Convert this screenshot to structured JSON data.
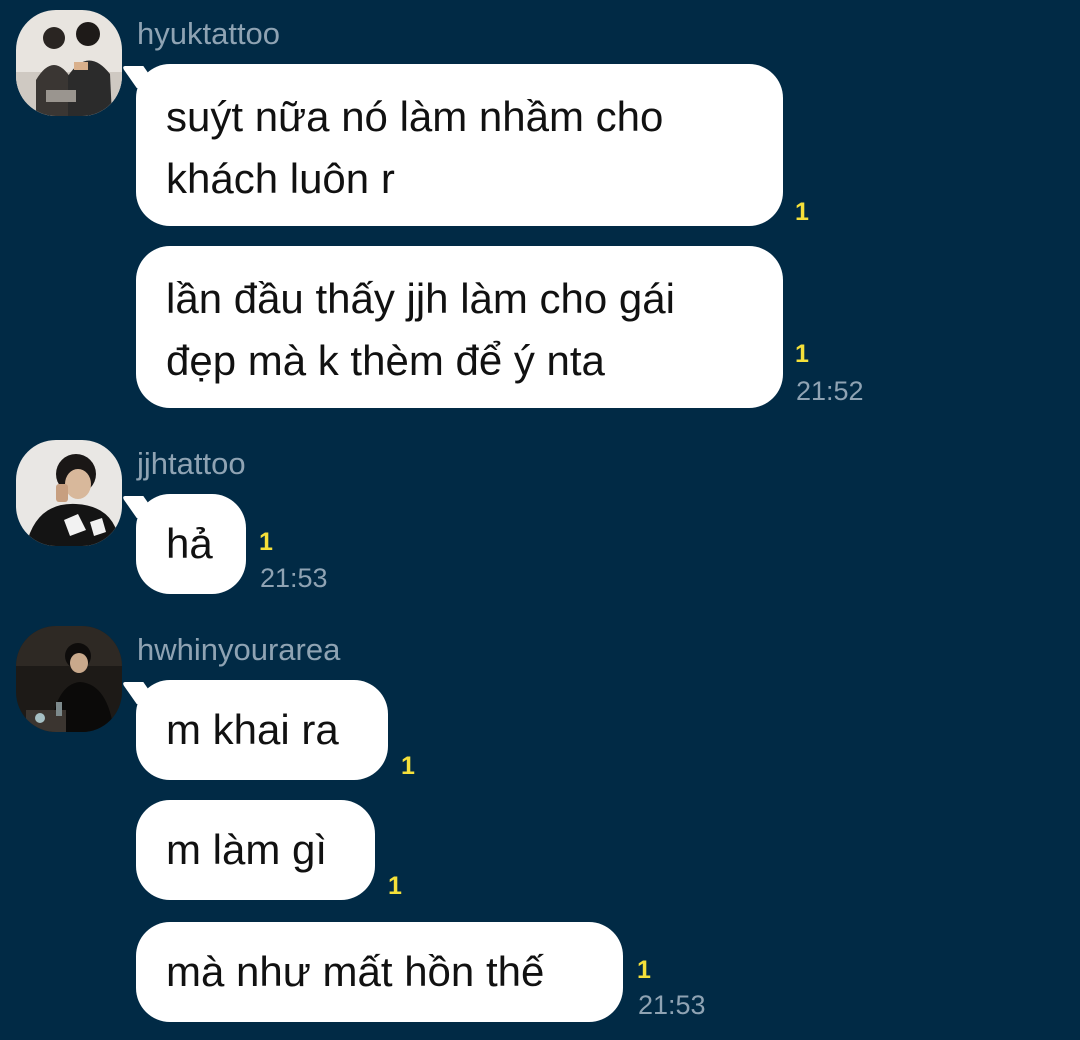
{
  "chat": {
    "groups": [
      {
        "sender": "hyuktattoo",
        "avatar_icon": "user-avatar-photo",
        "messages": [
          {
            "lines": [
              "suýt nữa nó làm nhầm cho",
              "khách luôn r"
            ],
            "unread": "1",
            "time": ""
          },
          {
            "lines": [
              "lần đầu thấy jjh làm cho gái",
              "đẹp mà k thèm để ý nta"
            ],
            "unread": "1",
            "time": "21:52"
          }
        ]
      },
      {
        "sender": "jjhtattoo",
        "avatar_icon": "user-avatar-photo",
        "messages": [
          {
            "lines": [
              "hả"
            ],
            "unread": "1",
            "time": "21:53"
          }
        ]
      },
      {
        "sender": "hwhinyourarea",
        "avatar_icon": "user-avatar-photo",
        "messages": [
          {
            "lines": [
              "m khai ra"
            ],
            "unread": "1",
            "time": ""
          },
          {
            "lines": [
              "m làm gì"
            ],
            "unread": "1",
            "time": ""
          },
          {
            "lines": [
              "mà như mất hồn thế"
            ],
            "unread": "1",
            "time": "21:53"
          }
        ]
      }
    ]
  },
  "colors": {
    "background": "#012a45",
    "bubble": "#ffffff",
    "unread": "#f5e03a",
    "meta_text": "#8fa3b3"
  }
}
